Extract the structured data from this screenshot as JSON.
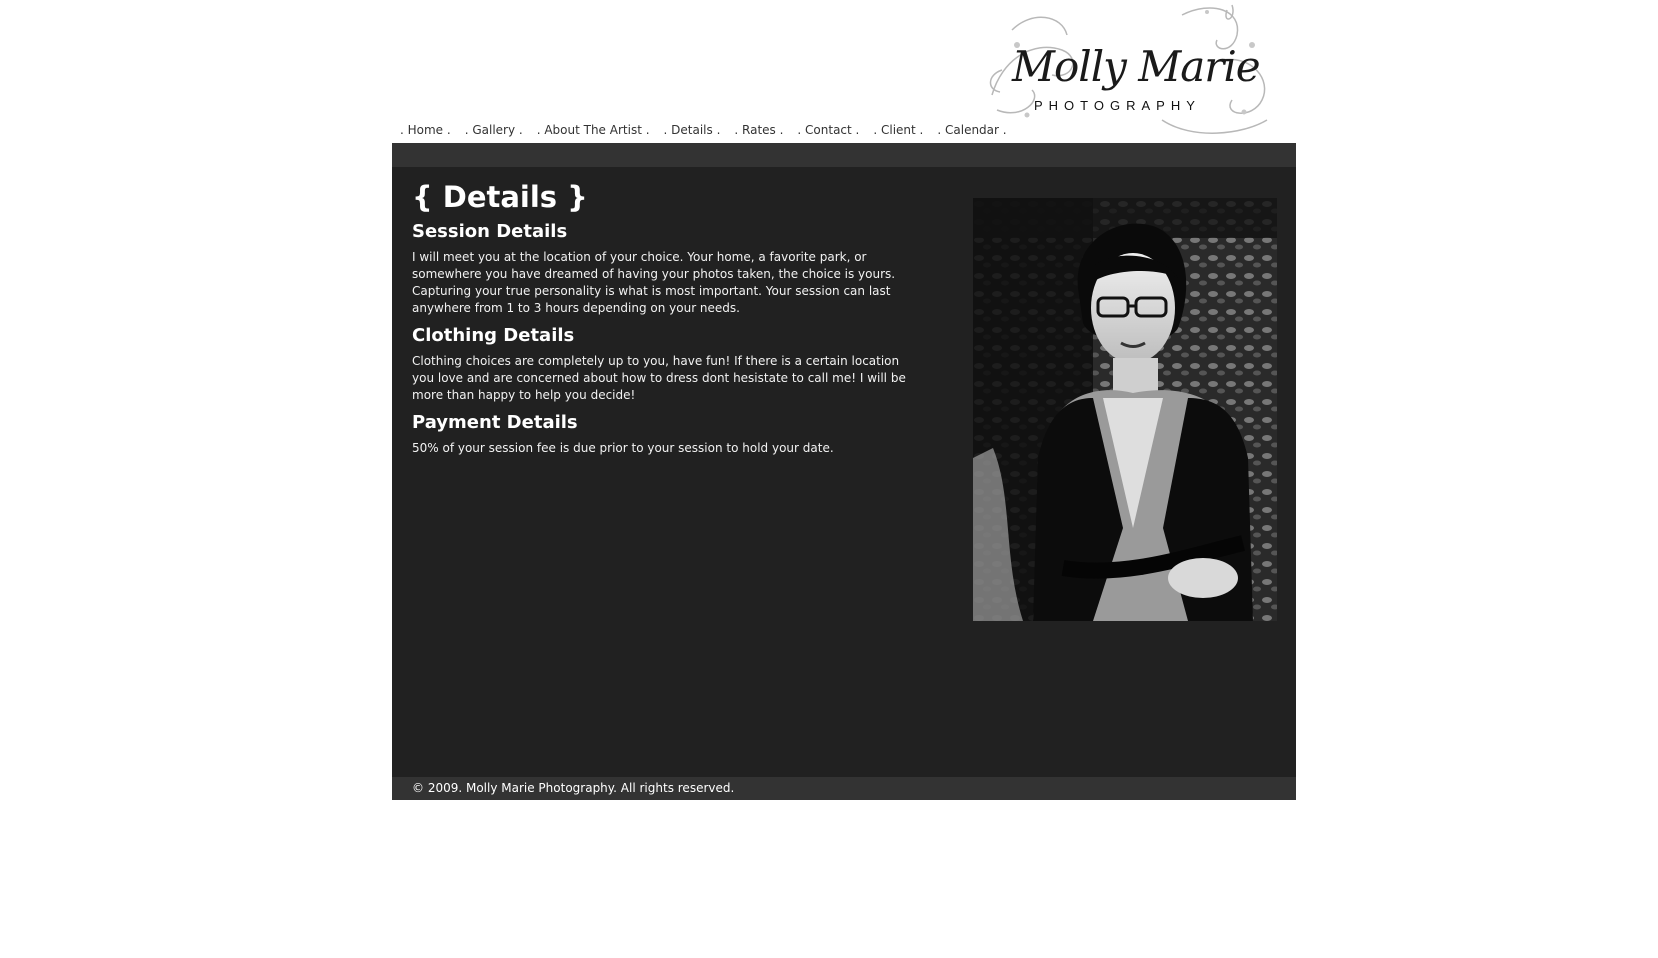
{
  "logo": {
    "script_text": "Molly Marie",
    "sub_text": "PHOTOGRAPHY"
  },
  "nav": {
    "items": [
      {
        "label": ". Home ."
      },
      {
        "label": ". Gallery ."
      },
      {
        "label": ". About The Artist ."
      },
      {
        "label": ". Details ."
      },
      {
        "label": ". Rates ."
      },
      {
        "label": ". Contact ."
      },
      {
        "label": ". Client ."
      },
      {
        "label": ". Calendar ."
      }
    ]
  },
  "page": {
    "title": "{ Details }",
    "sections": [
      {
        "heading": "Session Details",
        "body": "I will meet you at the location of your choice. Your home, a favorite park, or somewhere you have dreamed of having your photos taken, the choice is yours. Capturing your true personality is what is most important. Your session can last anywhere from 1 to 3 hours depending on your needs."
      },
      {
        "heading": "Clothing Details",
        "body": "Clothing choices are completely up to you, have fun! If there is a certain location you love and are concerned about how to dress dont hesistate to call me! I will be more than happy to help you decide!"
      },
      {
        "heading": "Payment Details",
        "body": "50% of your session fee is due prior to your session to hold your date."
      }
    ]
  },
  "footer": {
    "copyright": "© 2009. Molly Marie Photography. All rights reserved."
  },
  "colors": {
    "page_bg": "#ffffff",
    "main_bg": "#212121",
    "bar_bg": "#333333",
    "text": "#ffffff"
  }
}
